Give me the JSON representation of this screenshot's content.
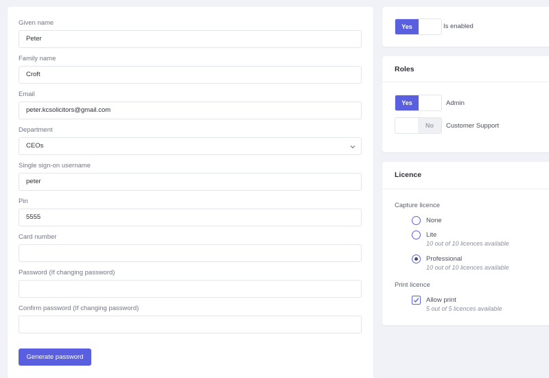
{
  "form": {
    "fields": [
      {
        "label": "Given name",
        "value": "Peter"
      },
      {
        "label": "Family name",
        "value": "Croft"
      },
      {
        "label": "Email",
        "value": "peter.kcsolicitors@gmail.com"
      },
      {
        "label": "Department",
        "value": "CEOs"
      },
      {
        "label": "Single sign-on username",
        "value": "peter"
      },
      {
        "label": "Pin",
        "value": "5555"
      },
      {
        "label": "Card number",
        "value": ""
      },
      {
        "label": "Password (If changing password)",
        "value": ""
      },
      {
        "label": "Confirm password (If changing password)",
        "value": ""
      }
    ],
    "department_chevron": "chevron-down-icon",
    "generate_password_label": "Generate password"
  },
  "enabled": {
    "yes_label": "Yes",
    "label": "Is enabled",
    "value": true
  },
  "roles": {
    "title": "Roles",
    "items": [
      {
        "label": "Admin",
        "state_label": "Yes",
        "value": true
      },
      {
        "label": "Customer Support",
        "state_label": "No",
        "value": false
      }
    ]
  },
  "licence": {
    "title": "Licence",
    "capture_label": "Capture licence",
    "capture_options": [
      {
        "label": "None",
        "note": "",
        "selected": false
      },
      {
        "label": "Lite",
        "note": "10 out of 10 licences available",
        "selected": false
      },
      {
        "label": "Professional",
        "note": "10 out of 10 licences available",
        "selected": true
      }
    ],
    "print_label": "Print licence",
    "print_option": {
      "label": "Allow print",
      "note": "5 out of 5 licences available",
      "checked": true
    }
  },
  "colors": {
    "accent": "#5a5fe0",
    "background": "#f1f2f7",
    "card": "#ffffff"
  }
}
